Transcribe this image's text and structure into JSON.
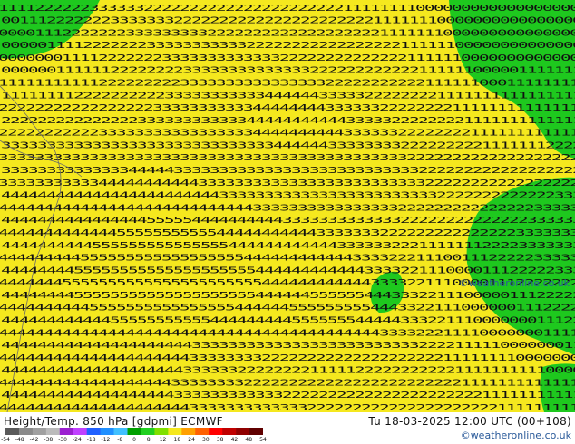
{
  "map": {
    "land_color": "#f5e81e",
    "high_color": "#1ec81e",
    "border_color": "#6a6a6a",
    "digit_color": "#111111",
    "field_rows": [
      "1111222222333333222222222222222222222211111111000000000000000000",
      "0011122222223333333222222222222222222222211111110000000000000000",
      "0000111222222233333333322222222222222222221111111000000000000000",
      "0000011112222222333333333332222222222222222211111100000000000000",
      "0000000111122222223333333333333222222222222221111110000000000000",
      "0000001111112222222233333333333333222222222222111111000001111111",
      "1111111111122222222233333333333333332222222222211111100011111111",
      "1111111122222222223333333333344444433333222222221111111111111111",
      "2222222222222222233333333333444444443333332222222211111111111111",
      "2222222222222223333333333334444444444433333222222221111111111111",
      "2222222222233333333333333333444444444433333322222222111111111111",
      "3333333333333333333333333333334444443333333322222222211111112222",
      "3333333333333333333333333333333333333333333332222222222222222222",
      "3333333333333344444333333333333333333333333333222222222222222222",
      "3333333333344444444444333333333333333333333333322222222222222222",
      "4444444444444444444444443333333333333333333333332222222222222333",
      "4444444444444444444444444444333333333333333322222222222222233333",
      "4444444444444444555554444444444333333333333322222222222222333333",
      "4444444444444555555555554444444444433333332222222222222223333333",
      "4444444444555555555555555444444444444333333222111111122223333333",
      "4444444445555555555555555554444444444443333222111001112222233333",
      "4444444455555555555555555555444444444444333322111000011122222333",
      "4444444555555555555555555555544444444444433332211100001112222222",
      "4444444455555555555555555555444444555555444333221110000011122222",
      "4444444444555555555555555544444455555555544433221110000001112222",
      "4444444444445555555555544444444455555554444433322111000000011122",
      "4444444444444444444444444444444444444444443333222111100000001111",
      "4444444444444444444443333333333333333333333333222211111000000011",
      "4444444444444444444443333333322222222222222222222111111110000000",
      "4444444444444444444433333322222222111112222222222211111111110000",
      "4444444444444444444333333332222222222222222222222221111111111111",
      "4444444444444444444333333333333222222222222222222222211111111111",
      "4444444444444444444443333333333333222222222222222222222111111111"
    ]
  },
  "colorbar": {
    "ticks": [
      "-54",
      "-48",
      "-42",
      "-38",
      "-30",
      "-24",
      "-18",
      "-12",
      "-8",
      "0",
      "8",
      "12",
      "18",
      "24",
      "30",
      "38",
      "42",
      "48",
      "54"
    ],
    "colors": [
      "#5a5a5a",
      "#8a8a8a",
      "#a0a0a0",
      "#bbbbbb",
      "#9b1fd0",
      "#c040ff",
      "#2060ff",
      "#2090ff",
      "#40c0ff",
      "#00a000",
      "#20d020",
      "#80e000",
      "#f5e81e",
      "#ffa000",
      "#ff6000",
      "#ff0000",
      "#c00000",
      "#900000",
      "#600000"
    ]
  },
  "footer": {
    "title_left": "Height/Temp. 850 hPa [gdpmi] ECMWF",
    "title_right": "Tu 18-03-2025 12:00 UTC (00+108)",
    "credit": "©weatheronline.co.uk"
  },
  "watermark": "©weatheronline.co.uk"
}
